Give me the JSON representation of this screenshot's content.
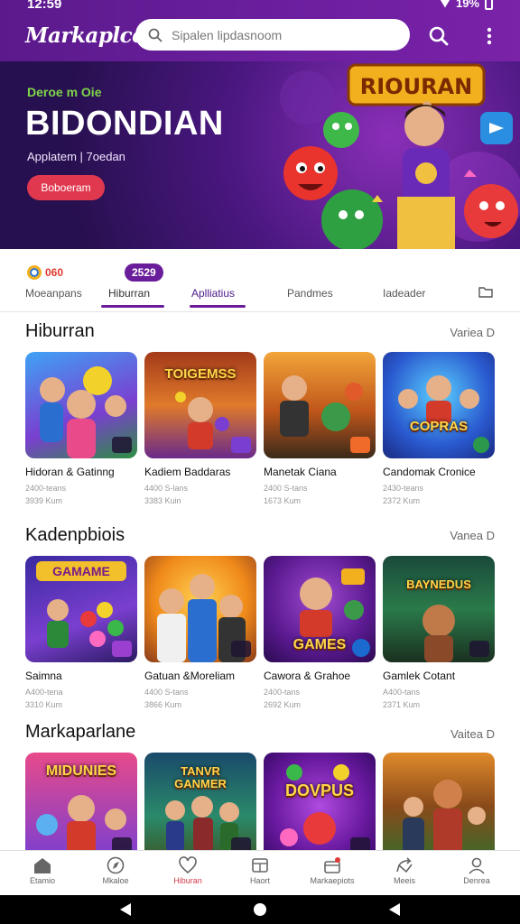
{
  "status": {
    "time": "12:59",
    "battery": "19%"
  },
  "appbar": {
    "brand": "Markaplce",
    "search_placeholder": "Sipalen lipdasnoom"
  },
  "hero": {
    "subtitle": "Deroe m Oie",
    "title": "BIDONDIAN",
    "caption": "Applatem | 7oedan",
    "cta": "Boboeram",
    "art_sign": "RIOURAN"
  },
  "tabs": [
    {
      "label": "Moeanpans",
      "badge": "060"
    },
    {
      "label": "Hiburran",
      "badge": "2529"
    },
    {
      "label": "Aplliatius"
    },
    {
      "label": "Pandmes"
    },
    {
      "label": "Iadeader"
    }
  ],
  "sections": [
    {
      "title": "Hiburran",
      "see_all": "Variea D",
      "cards": [
        {
          "name": "Hidoran & Gatinng",
          "meta1": "2400-teans",
          "meta2": "3939 Kum",
          "art": ""
        },
        {
          "name": "Kadiem Baddaras",
          "meta1": "4400 S-lans",
          "meta2": "3383 Kuin",
          "art": "TOIGEMSS"
        },
        {
          "name": "Manetak Ciana",
          "meta1": "2400 S-tans",
          "meta2": "1673 Kum",
          "art": ""
        },
        {
          "name": "Candomak Cronice",
          "meta1": "2430-teans",
          "meta2": "2372 Kum",
          "art": "COPRAS"
        }
      ]
    },
    {
      "title": "Kadenpbiois",
      "see_all": "Vanea D",
      "cards": [
        {
          "name": "Saimna",
          "meta1": "A400-tena",
          "meta2": "3310 Kum",
          "art": "GAMAME"
        },
        {
          "name": "Gatuan &Moreliam",
          "meta1": "4400 S-tans",
          "meta2": "3866 Kum",
          "art": ""
        },
        {
          "name": "Cawora & Grahoe",
          "meta1": "2400-tans",
          "meta2": "2692 Kum",
          "art": "GAMES"
        },
        {
          "name": "Gamlek Cotant",
          "meta1": "A400-tans",
          "meta2": "2371 Kum",
          "art": "BAYNEDUS"
        }
      ]
    },
    {
      "title": "Markaparlane",
      "see_all": "Vaitea D",
      "cards": [
        {
          "art": "MIDUNIES"
        },
        {
          "art": "TANVR GANMER"
        },
        {
          "art": "DOVPUS"
        },
        {
          "art": ""
        }
      ]
    }
  ],
  "bottom_nav": [
    {
      "label": "Etamio",
      "icon": "home-icon"
    },
    {
      "label": "Mkaloe",
      "icon": "compass-icon"
    },
    {
      "label": "Hiburan",
      "icon": "heart-icon",
      "active": true
    },
    {
      "label": "Haort",
      "icon": "cart-icon"
    },
    {
      "label": "Markaepiots",
      "icon": "gift-icon"
    },
    {
      "label": "Meeis",
      "icon": "share-icon"
    },
    {
      "label": "Denrea",
      "icon": "user-icon"
    }
  ],
  "colors": {
    "primary": "#6a1d9a",
    "accent": "#e0394f",
    "active_nav": "#d33a4a"
  }
}
